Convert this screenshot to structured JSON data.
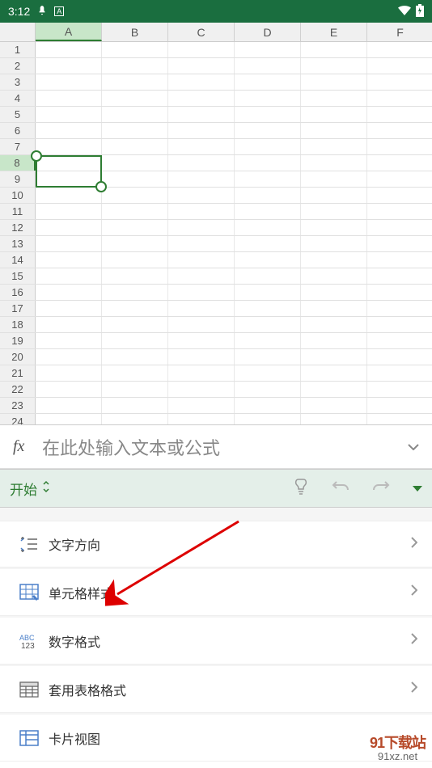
{
  "status": {
    "time": "3:12",
    "wifi": "▾",
    "battery": "▮"
  },
  "columns": [
    "A",
    "B",
    "C",
    "D",
    "E",
    "F"
  ],
  "rows": [
    "1",
    "2",
    "3",
    "4",
    "5",
    "6",
    "7",
    "8",
    "9",
    "10",
    "11",
    "12",
    "13",
    "14",
    "15",
    "16",
    "17",
    "18",
    "19",
    "20",
    "21",
    "22",
    "23",
    "24"
  ],
  "selected_column_index": 0,
  "selected_row_index": 7,
  "formula": {
    "label": "fx",
    "placeholder": "在此处输入文本或公式"
  },
  "ribbon": {
    "tab": "开始"
  },
  "menu": [
    {
      "key": "text-direction",
      "label": "文字方向"
    },
    {
      "key": "cell-style",
      "label": "单元格样式"
    },
    {
      "key": "number-format",
      "label": "数字格式"
    },
    {
      "key": "table-format",
      "label": "套用表格格式"
    },
    {
      "key": "card-view",
      "label": "卡片视图"
    }
  ],
  "watermark": {
    "top_number": "91",
    "top_text": "下载站",
    "bottom": "91xz.net"
  }
}
